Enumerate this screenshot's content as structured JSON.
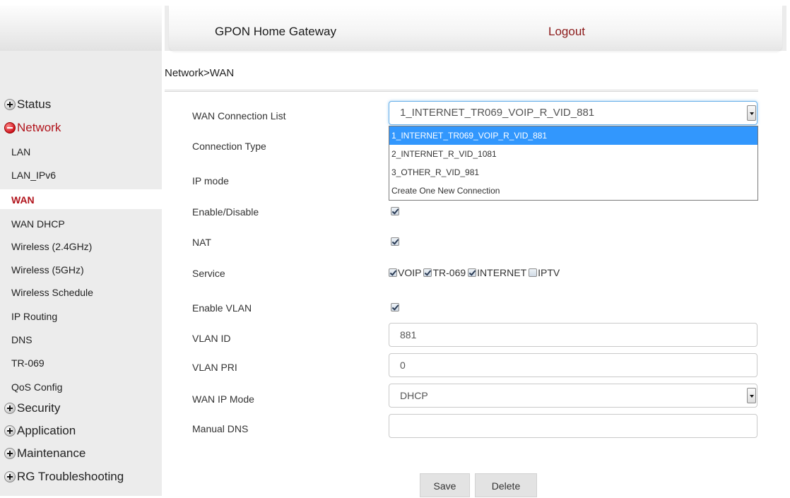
{
  "header": {
    "title": "GPON Home Gateway",
    "logout": "Logout"
  },
  "breadcrumb": "Network>WAN",
  "sidebar": {
    "status": "Status",
    "network": "Network",
    "network_items": [
      "LAN",
      "LAN_IPv6",
      "WAN",
      "WAN DHCP",
      "Wireless (2.4GHz)",
      "Wireless (5GHz)",
      "Wireless Schedule",
      "IP Routing",
      "DNS",
      "TR-069",
      "QoS Config"
    ],
    "security": "Security",
    "application": "Application",
    "maintenance": "Maintenance",
    "rg_troubleshooting": "RG Troubleshooting",
    "active_item": "WAN"
  },
  "form": {
    "wan_connection_list_label": "WAN Connection List",
    "wan_connection_list_value": "1_INTERNET_TR069_VOIP_R_VID_881",
    "wan_connection_options": [
      "1_INTERNET_TR069_VOIP_R_VID_881",
      "2_INTERNET_R_VID_1081",
      "3_OTHER_R_VID_981",
      "Create One New Connection"
    ],
    "connection_type_label": "Connection Type",
    "ip_mode_label": "IP mode",
    "enable_label": "Enable/Disable",
    "enable_checked": true,
    "nat_label": "NAT",
    "nat_checked": true,
    "service_label": "Service",
    "services": [
      {
        "label": "VOIP",
        "checked": true
      },
      {
        "label": "TR-069",
        "checked": true
      },
      {
        "label": "INTERNET",
        "checked": true
      },
      {
        "label": "IPTV",
        "checked": false
      }
    ],
    "enable_vlan_label": "Enable VLAN",
    "enable_vlan_checked": true,
    "vlan_id_label": "VLAN ID",
    "vlan_id_value": "881",
    "vlan_pri_label": "VLAN PRI",
    "vlan_pri_value": "0",
    "wan_ip_mode_label": "WAN IP Mode",
    "wan_ip_mode_value": "DHCP",
    "manual_dns_label": "Manual DNS",
    "manual_dns_value": ""
  },
  "buttons": {
    "save": "Save",
    "delete": "Delete"
  },
  "colors": {
    "accent_red": "#b1141c",
    "selection_blue": "#3297fd",
    "sidebar_bg": "#ececec"
  }
}
